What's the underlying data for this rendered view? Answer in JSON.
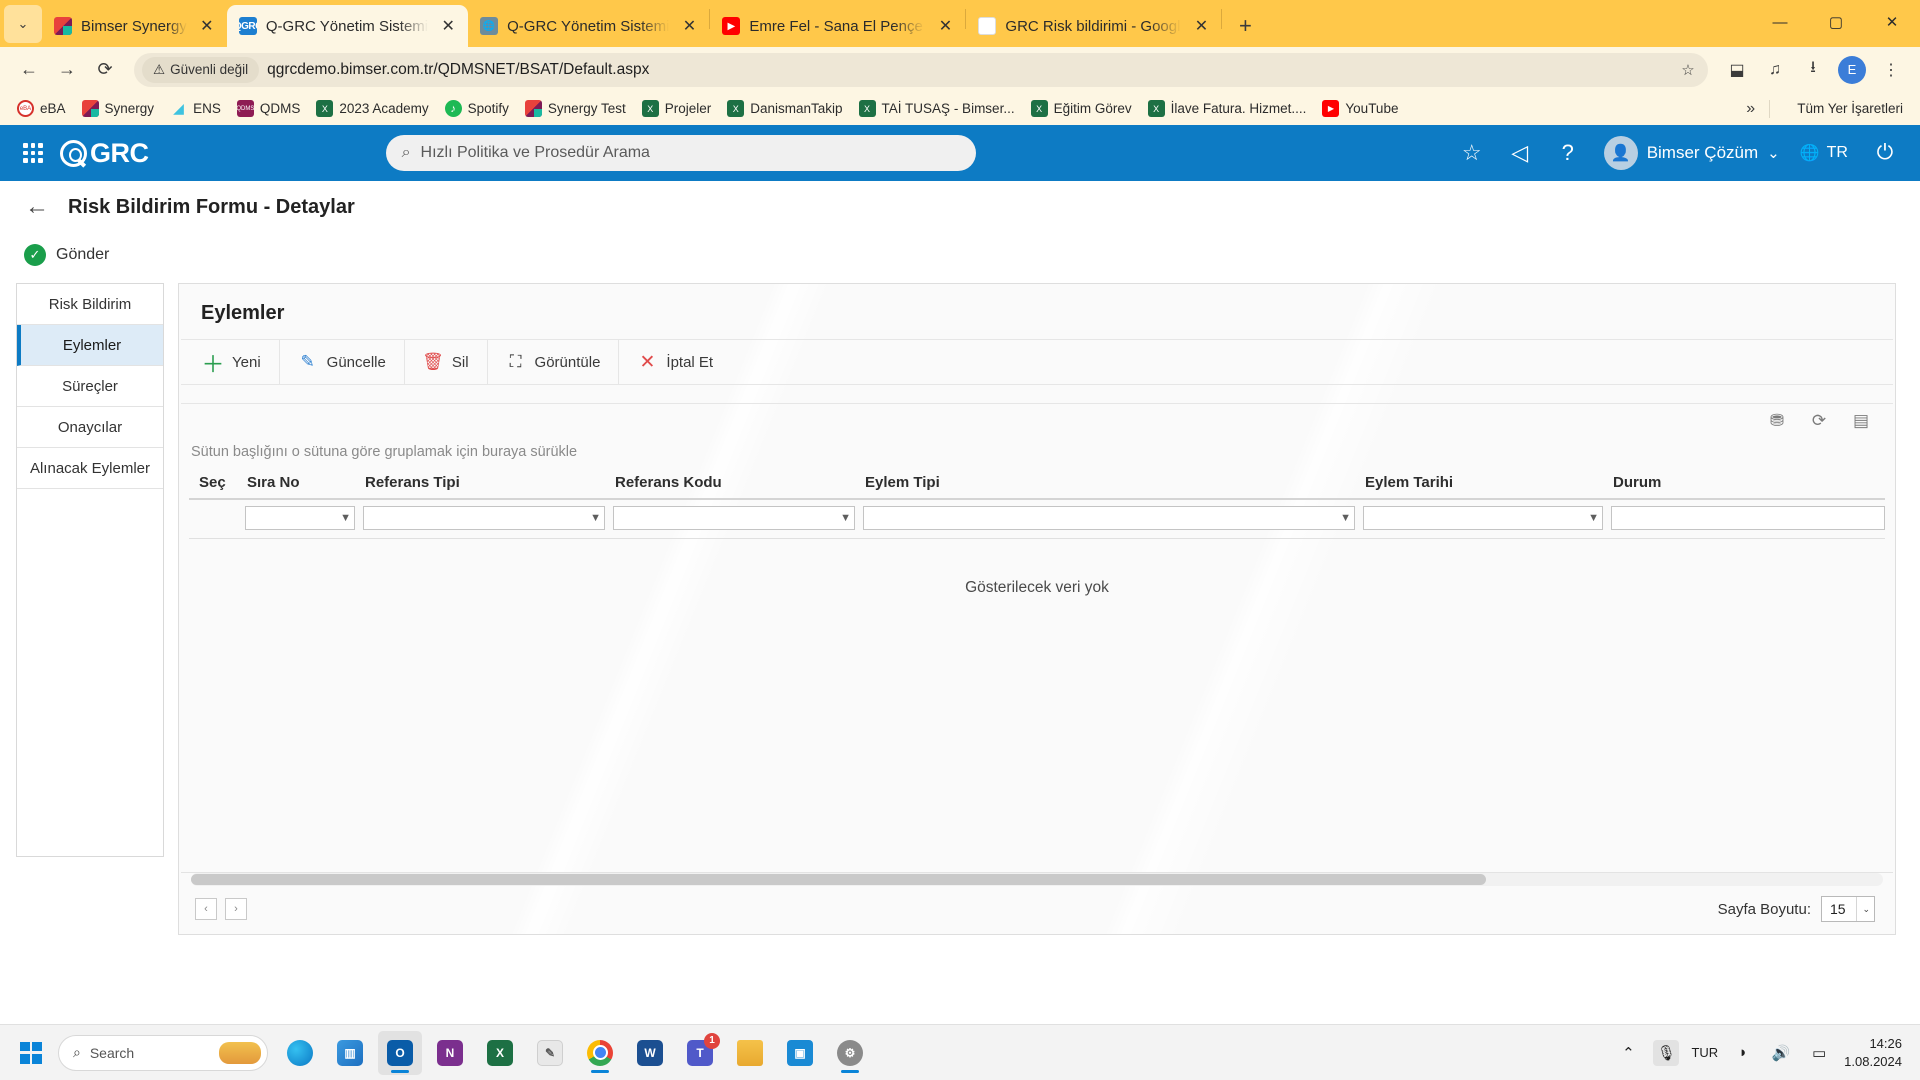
{
  "browser": {
    "tabs": [
      {
        "title": "Bimser Synergy",
        "favicon": "bimser-icon",
        "active": false
      },
      {
        "title": "Q-GRC Yönetim Sistemi",
        "favicon": "qgrc-icon",
        "active": true
      },
      {
        "title": "Q-GRC Yönetim Sistemi",
        "favicon": "globe-icon",
        "active": false
      },
      {
        "title": "Emre Fel - Sana El Pençe Durma",
        "favicon": "youtube-icon",
        "active": false
      },
      {
        "title": "GRC Risk bildirimi - Google'da A",
        "favicon": "google-icon",
        "active": false
      }
    ],
    "tab_close_label": "✕",
    "new_tab_label": "+",
    "tab_list_label": "⌄",
    "window": {
      "minimize": "—",
      "maximize": "▢",
      "close": "✕"
    },
    "nav": {
      "back": "←",
      "forward": "→",
      "reload": "⟳"
    },
    "omnibox": {
      "security_label": "Güvenli değil",
      "security_icon": "warning-triangle-icon",
      "url": "qgrcdemo.bimser.com.tr/QDMSNET/BSAT/Default.aspx",
      "bookmark_star": "☆"
    },
    "toolbar_icons": {
      "extensions": "⬓",
      "reading_list": "♫",
      "downloads": "⭳",
      "profile_initial": "E",
      "menu": "⋮"
    },
    "bookmarks": [
      {
        "label": "eBA",
        "icon": "eba-icon"
      },
      {
        "label": "Synergy",
        "icon": "synergy-icon"
      },
      {
        "label": "ENS",
        "icon": "ens-icon"
      },
      {
        "label": "QDMS",
        "icon": "qdms-icon"
      },
      {
        "label": "2023 Academy",
        "icon": "excel-icon"
      },
      {
        "label": "Spotify",
        "icon": "spotify-icon"
      },
      {
        "label": "Synergy Test",
        "icon": "synergy-icon"
      },
      {
        "label": "Projeler",
        "icon": "excel-icon"
      },
      {
        "label": "DanismanTakip",
        "icon": "excel-icon"
      },
      {
        "label": "TAİ TUSAŞ - Bimser...",
        "icon": "excel-icon"
      },
      {
        "label": "Eğitim Görev",
        "icon": "excel-icon"
      },
      {
        "label": "İlave Fatura. Hizmet....",
        "icon": "excel-icon"
      },
      {
        "label": "YouTube",
        "icon": "youtube-icon"
      }
    ],
    "bookmarks_overflow": "»",
    "bookmarks_all": {
      "label": "Tüm Yer İşaretleri",
      "icon": "folder-icon"
    }
  },
  "app": {
    "header": {
      "apps_grid_icon": "apps-grid-icon",
      "logo_text": "GRC",
      "search_placeholder": "Hızlı Politika ve Prosedür Arama",
      "search_icon": "search-icon",
      "icons": [
        {
          "name": "favorites-star-icon",
          "glyph": "☆"
        },
        {
          "name": "announcement-megaphone-icon",
          "glyph": "◁"
        },
        {
          "name": "help-question-icon",
          "glyph": "?"
        }
      ],
      "user": {
        "name": "Bimser Çözüm",
        "avatar_icon": "user-avatar-icon",
        "caret": "⌄"
      },
      "language": {
        "label": "TR",
        "icon": "globe-language-icon"
      },
      "power_icon": "power-icon"
    },
    "page": {
      "back_icon": "back-arrow-icon",
      "title": "Risk Bildirim Formu - Detaylar",
      "submit": {
        "label": "Gönder",
        "icon": "check-circle-icon"
      }
    },
    "sidebar": {
      "items": [
        {
          "label": "Risk Bildirim",
          "active": false
        },
        {
          "label": "Eylemler",
          "active": true
        },
        {
          "label": "Süreçler",
          "active": false
        },
        {
          "label": "Onaycılar",
          "active": false
        },
        {
          "label": "Alınacak Eylemler",
          "active": false
        }
      ]
    },
    "panel": {
      "title": "Eylemler",
      "commands": [
        {
          "label": "Yeni",
          "icon": "plus-icon"
        },
        {
          "label": "Güncelle",
          "icon": "pencil-icon"
        },
        {
          "label": "Sil",
          "icon": "trash-icon"
        },
        {
          "label": "Görüntüle",
          "icon": "expand-icon"
        },
        {
          "label": "İptal Et",
          "icon": "x-icon"
        }
      ],
      "grid_tools": [
        {
          "name": "clear-filter-icon",
          "glyph": "⛃"
        },
        {
          "name": "refresh-icon",
          "glyph": "⟳"
        },
        {
          "name": "column-chooser-icon",
          "glyph": "▤"
        }
      ],
      "group_hint": "Sütun başlığını o sütuna göre gruplamak için buraya sürükle",
      "columns": [
        {
          "key": "sec",
          "label": "Seç"
        },
        {
          "key": "sira_no",
          "label": "Sıra No"
        },
        {
          "key": "referans_tipi",
          "label": "Referans Tipi"
        },
        {
          "key": "referans_kodu",
          "label": "Referans Kodu"
        },
        {
          "key": "eylem_tipi",
          "label": "Eylem Tipi"
        },
        {
          "key": "eylem_tarihi",
          "label": "Eylem Tarihi"
        },
        {
          "key": "durum",
          "label": "Durum"
        }
      ],
      "filter_icon": "funnel-icon",
      "filter_values": {
        "sira_no": "",
        "referans_tipi": "",
        "referans_kodu": "",
        "eylem_tipi": "",
        "eylem_tarihi": "",
        "durum": ""
      },
      "rows": [],
      "empty_message": "Gösterilecek veri yok",
      "pager": {
        "prev": "‹",
        "next": "›"
      },
      "page_size": {
        "label": "Sayfa Boyutu:",
        "value": "15",
        "caret": "⌄"
      }
    }
  },
  "taskbar": {
    "start_icon": "windows-start-icon",
    "search": {
      "placeholder": "Search",
      "icon": "search-icon"
    },
    "apps": [
      {
        "name": "edge-icon",
        "glyph": "",
        "active": false,
        "badge": "",
        "running": false
      },
      {
        "name": "widgets-icon",
        "glyph": "▥",
        "active": false,
        "badge": "",
        "running": false
      },
      {
        "name": "outlook-icon",
        "glyph": "O",
        "active": true,
        "badge": "",
        "running": true
      },
      {
        "name": "onenote-icon",
        "glyph": "N",
        "active": false,
        "badge": "",
        "running": false
      },
      {
        "name": "excel-icon",
        "glyph": "X",
        "active": false,
        "badge": "",
        "running": false
      },
      {
        "name": "notepad-icon",
        "glyph": "✎",
        "active": false,
        "badge": "",
        "running": false
      },
      {
        "name": "chrome-icon",
        "glyph": "",
        "active": false,
        "badge": "",
        "running": true
      },
      {
        "name": "word-icon",
        "glyph": "W",
        "active": false,
        "badge": "",
        "running": false
      },
      {
        "name": "teams-icon",
        "glyph": "T",
        "active": false,
        "badge": "1",
        "running": false
      },
      {
        "name": "file-explorer-icon",
        "glyph": "",
        "active": false,
        "badge": "",
        "running": false
      },
      {
        "name": "app-icon",
        "glyph": "▣",
        "active": false,
        "badge": "",
        "running": false
      },
      {
        "name": "settings-gear-icon",
        "glyph": "⚙",
        "active": false,
        "badge": "",
        "running": true
      }
    ],
    "tray": {
      "chevron": "⌃",
      "mic_muted_icon": "mic-muted-icon",
      "language": "TUR",
      "wifi_icon": "wifi-icon",
      "volume_icon": "volume-icon",
      "battery_icon": "battery-icon",
      "time": "14:26",
      "date": "1.08.2024"
    }
  }
}
